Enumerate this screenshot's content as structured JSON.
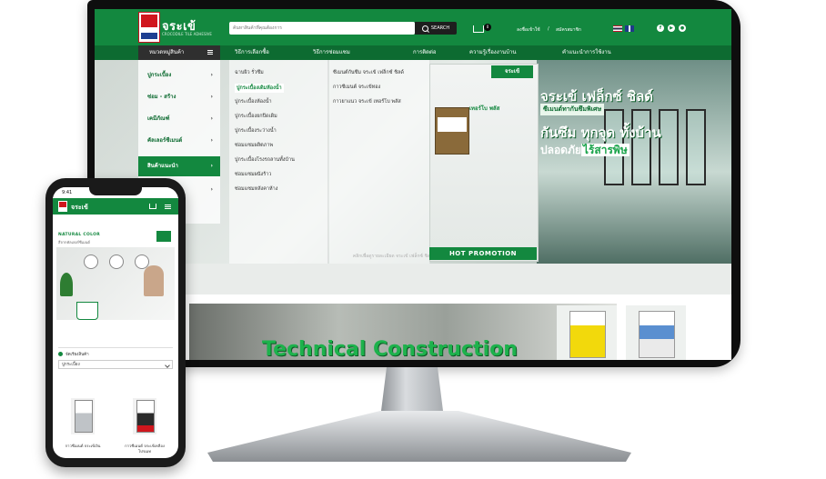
{
  "site": {
    "brand": "จระเข้",
    "brand_tagline": "CROCODILE TILE ADHESIVE",
    "search_placeholder": "ค้นหาสินค้าที่คุณต้องการ",
    "search_button": "SEARCH",
    "cart_count": "0",
    "header_links": [
      "ลงชื่อเข้าใช้",
      "/",
      "สมัครสมาชิก"
    ],
    "social": [
      "f",
      "▶",
      "●"
    ]
  },
  "nav": {
    "category_button": "หมวดหมู่สินค้า",
    "items": [
      "วิธีการเลือกซื้อ",
      "วิธีการซ่อมแซม",
      "การติดต่อ",
      "ความรู้เรื่องงานบ้าน",
      "คำแนะนำการใช้งาน"
    ]
  },
  "mega_menu": {
    "categories": [
      "ปูกระเบื้อง",
      "ซ่อม - สร้าง",
      "เคมีภัณฑ์",
      "คัลเลอร์ซีเมนต์",
      "สินค้าแนะนำ",
      ""
    ],
    "active_index": 4,
    "col1": [
      "ฉาบผิว รั่วซึม",
      "ปูกระเบื้องเดิมห้องน้ำ",
      "ปูกระเบื้องห้องน้ำ",
      "ปูกระเบื้องยกปิดเดิม",
      "ปูกระเบื้องระว่างน้ำ",
      "ซ่อมแซมผลิตภาพ",
      "ปูกระเบื้องโรงรถลานทั้งบ้าน",
      "ซ่อมแซมผนังร้าว",
      "ซ่อมแซมหลังคาห้าง"
    ],
    "col2": [
      "ซีเมนต์กันซึม จระเข้ เฟล็กซ์ ชิลด์",
      "กาวซีเมนต์ จระเข้ทอง",
      "กาวยาแนว จระเข้ เทอร์โบ พลัส"
    ]
  },
  "promo": {
    "logo": "จระเข้",
    "text": "เทอร์โบ พลัส",
    "ribbon": "HOT PROMOTION"
  },
  "hero": {
    "line1": "จระเข้ เฟล็กซ์ ชิลด์",
    "line2": "ซีเมนต์ทากันซึมพิเศษ",
    "line3": "กันซึม ทุกจุด ทั้งบ้าน",
    "line4a": "ปลอดภัย",
    "line4b": "ไร้สารพิษ",
    "caption": "คลิกเพื่อดูรายละเอียด จระเข้ เฟล็กซ์ ชิลด์ ยกกันน้ำได้ไม่รั่วซึม"
  },
  "band": {
    "title": "Technical Construction"
  },
  "phone": {
    "time": "9:41",
    "brand": "จระเข้",
    "natural_title": "NATURAL COLOR",
    "natural_sub": "สีจากคัลเลอร์ซีเมนต์",
    "filter_label": "จัดเรียงสินค้า",
    "select_value": "ปูกระเบื้อง",
    "products": [
      "กาวซีเมนต์ จระเข้เงิน",
      "กาวซีเมนต์ จระเข้เหลือง โปรเมท"
    ]
  },
  "colors": {
    "brand_green": "#13883f",
    "dark_green": "#0d6b31",
    "brand_red": "#d0161d"
  }
}
